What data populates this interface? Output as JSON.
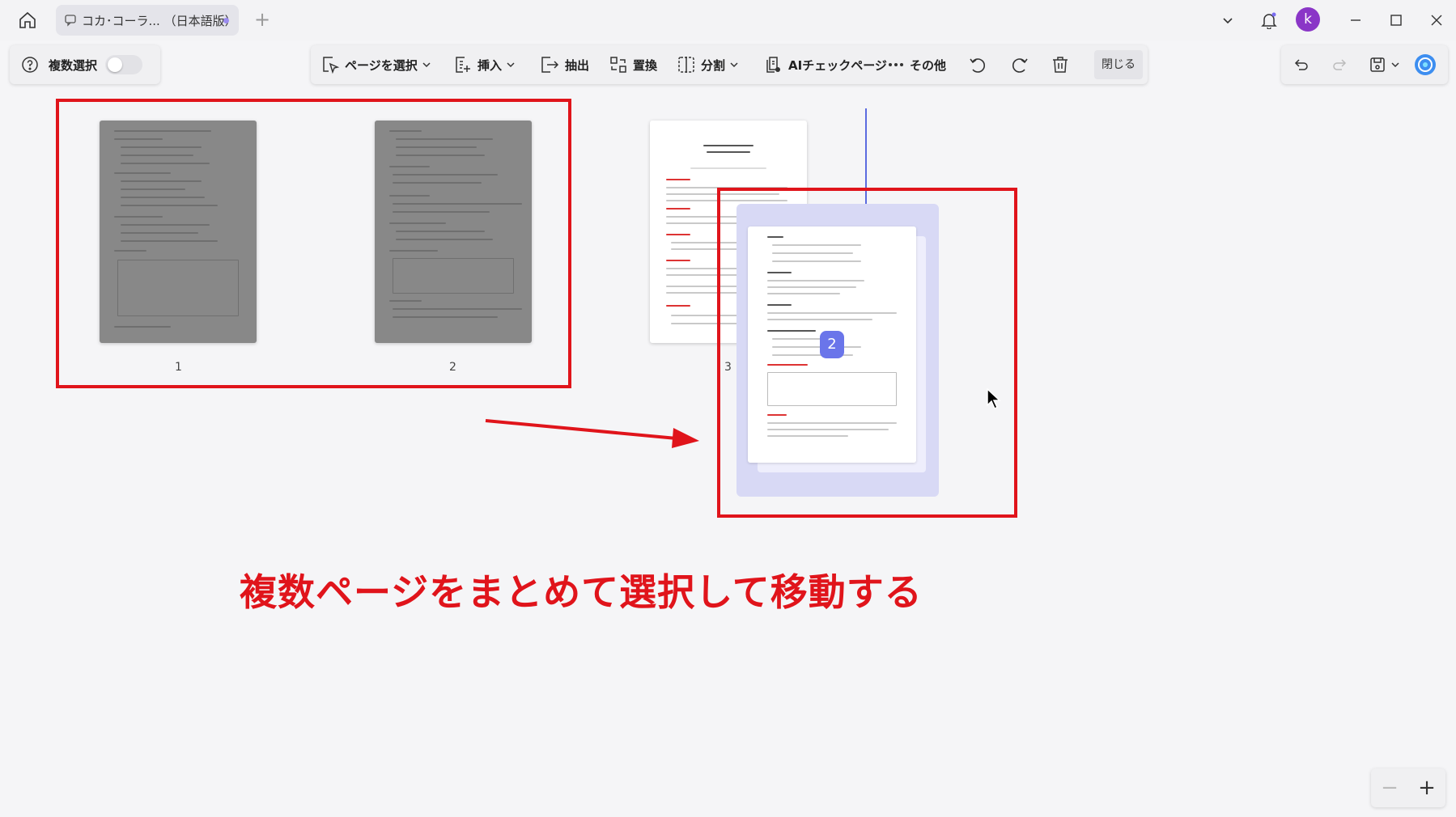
{
  "titlebar": {
    "tab_title": "コカ･コーラ... （日本語版）",
    "new_tab": "+",
    "avatar_letter": "k"
  },
  "toolbar": {
    "multi_select_label": "複数選択",
    "multi_select_on": false,
    "items": [
      {
        "label": "ページを選択",
        "icon": "page-select-icon",
        "dropdown": true
      },
      {
        "label": "挿入",
        "icon": "insert-icon",
        "dropdown": true
      },
      {
        "label": "抽出",
        "icon": "extract-icon",
        "dropdown": false
      },
      {
        "label": "置換",
        "icon": "replace-icon",
        "dropdown": false
      },
      {
        "label": "分割",
        "icon": "split-icon",
        "dropdown": true
      },
      {
        "label": "AIチェックページ",
        "icon": "ai-check-icon",
        "dropdown": false
      },
      {
        "label": "その他",
        "icon": "more-icon",
        "dropdown": false
      }
    ],
    "close_label": "閉じる"
  },
  "pages": [
    {
      "number": "1",
      "selected": true
    },
    {
      "number": "2",
      "selected": true
    },
    {
      "number": "3",
      "selected": false
    }
  ],
  "drag": {
    "count": "2"
  },
  "annotation": {
    "caption": "複数ページをまとめて選択して移動する",
    "color": "#e0141b"
  },
  "zoom": {
    "minus": "−",
    "plus": "+"
  },
  "colors": {
    "accent": "#6a75ea",
    "avatar": "#8a36c7",
    "highlight": "#e0141b"
  }
}
